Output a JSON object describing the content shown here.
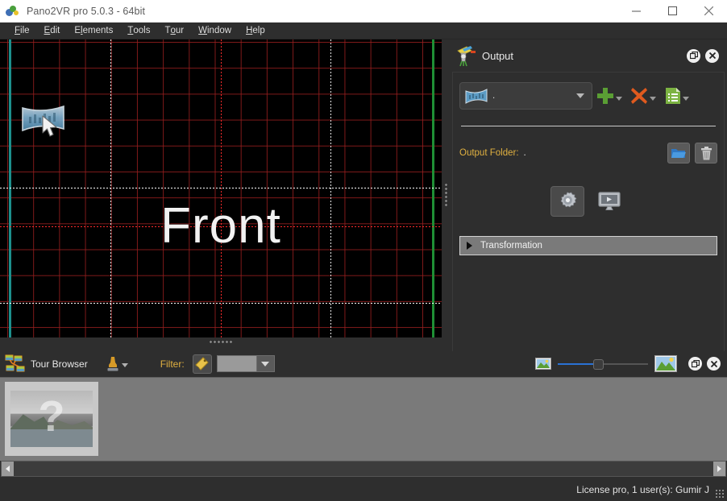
{
  "window": {
    "title": "Pano2VR pro 5.0.3 - 64bit",
    "app_icon": "pano2vr-logo-icon",
    "minimize_label": "—",
    "maximize_label": "□",
    "close_label": "✕"
  },
  "menu": {
    "items": [
      {
        "label": "File",
        "mnemonic": "F"
      },
      {
        "label": "Edit",
        "mnemonic": "E"
      },
      {
        "label": "Elements",
        "mnemonic": "l"
      },
      {
        "label": "Tools",
        "mnemonic": "T"
      },
      {
        "label": "Tour",
        "mnemonic": "o"
      },
      {
        "label": "Window",
        "mnemonic": "W"
      },
      {
        "label": "Help",
        "mnemonic": "H"
      }
    ]
  },
  "canvas": {
    "face_label": "Front",
    "grid_color": "#961e1e",
    "background": "#000000",
    "left_edge_color": "#1d8f8c",
    "right_edge_color": "#1f8f35",
    "guide_color": "#ff2b2b",
    "pano_sprite_name": "panorama-patch-sprite",
    "cursor_name": "mouse-cursor-arrow"
  },
  "output_panel": {
    "icon": "output-publish-icon",
    "title": "Output",
    "undock_label": "⧉",
    "close_label": "✕",
    "output_type": {
      "thumb_icon": "panorama-thumb-icon",
      "value": ".",
      "dropdown_icon": "chevron-down-icon"
    },
    "actions": [
      {
        "name": "add-output-button",
        "icon": "plus-icon",
        "color": "#5a9e34"
      },
      {
        "name": "remove-output-button",
        "icon": "cross-icon",
        "color": "#e05a1e"
      },
      {
        "name": "output-list-button",
        "icon": "document-list-icon",
        "color": "#7cb342"
      }
    ],
    "folder": {
      "label": "Output Folder:",
      "value": ".",
      "browse_icon": "open-folder-icon",
      "clear_icon": "trash-icon"
    },
    "big_actions": [
      {
        "name": "output-settings-button",
        "icon": "gear-icon"
      },
      {
        "name": "output-preview-button",
        "icon": "monitor-play-icon"
      }
    ],
    "section": {
      "label": "Transformation",
      "expander_icon": "triangle-right-icon",
      "expanded": false
    }
  },
  "tour_browser": {
    "icon": "tour-browser-icon",
    "title": "Tour Browser",
    "stamp_icon": "stamp-icon",
    "stamp_dropdown_icon": "chevron-down-icon",
    "filter_label": "Filter:",
    "filter_tag_icon": "tag-pencil-icon",
    "filter_value": "",
    "filter_dropdown_icon": "chevron-down-icon",
    "zoom_small_icon": "image-small-icon",
    "zoom_large_icon": "image-large-icon",
    "zoom_value": 40,
    "undock_label": "⧉",
    "close_label": "✕",
    "items": [
      {
        "name": "untitled-node-thumbnail",
        "placeholder": "?"
      }
    ],
    "scroll_left_icon": "triangle-left-icon",
    "scroll_right_icon": "triangle-right-icon"
  },
  "statusbar": {
    "text": "License pro, 1 user(s): Gumir J",
    "grip_icon": "resize-grip-icon"
  }
}
